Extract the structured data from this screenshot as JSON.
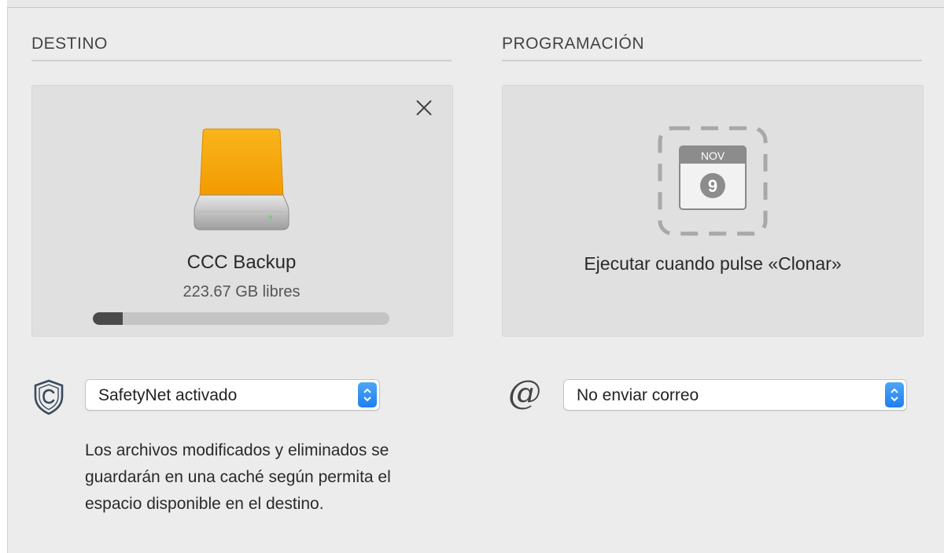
{
  "destination": {
    "section_title": "DESTINO",
    "volume": {
      "name": "CCC Backup",
      "free_space": "223.67 GB libres",
      "used_fraction": 0.1,
      "icon": "external-drive-icon",
      "drive_color": "#f7a600"
    },
    "close_icon": "close-icon",
    "safetynet": {
      "icon": "safetynet-shield-icon",
      "selected": "SafetyNet activado",
      "description": "Los archivos modificados y eliminados se guardarán en una caché según permita el espacio disponible en el destino."
    }
  },
  "schedule": {
    "section_title": "PROGRAMACIÓN",
    "calendar_icon": {
      "name": "calendar-icon",
      "month": "NOV",
      "day": "9"
    },
    "label": "Ejecutar cuando pulse «Clonar»",
    "email": {
      "icon": "at-sign-icon",
      "icon_glyph": "@",
      "selected": "No enviar correo"
    }
  },
  "colors": {
    "accent": "#2a86f3",
    "background": "#ececec",
    "well": "#e0e0e0"
  }
}
